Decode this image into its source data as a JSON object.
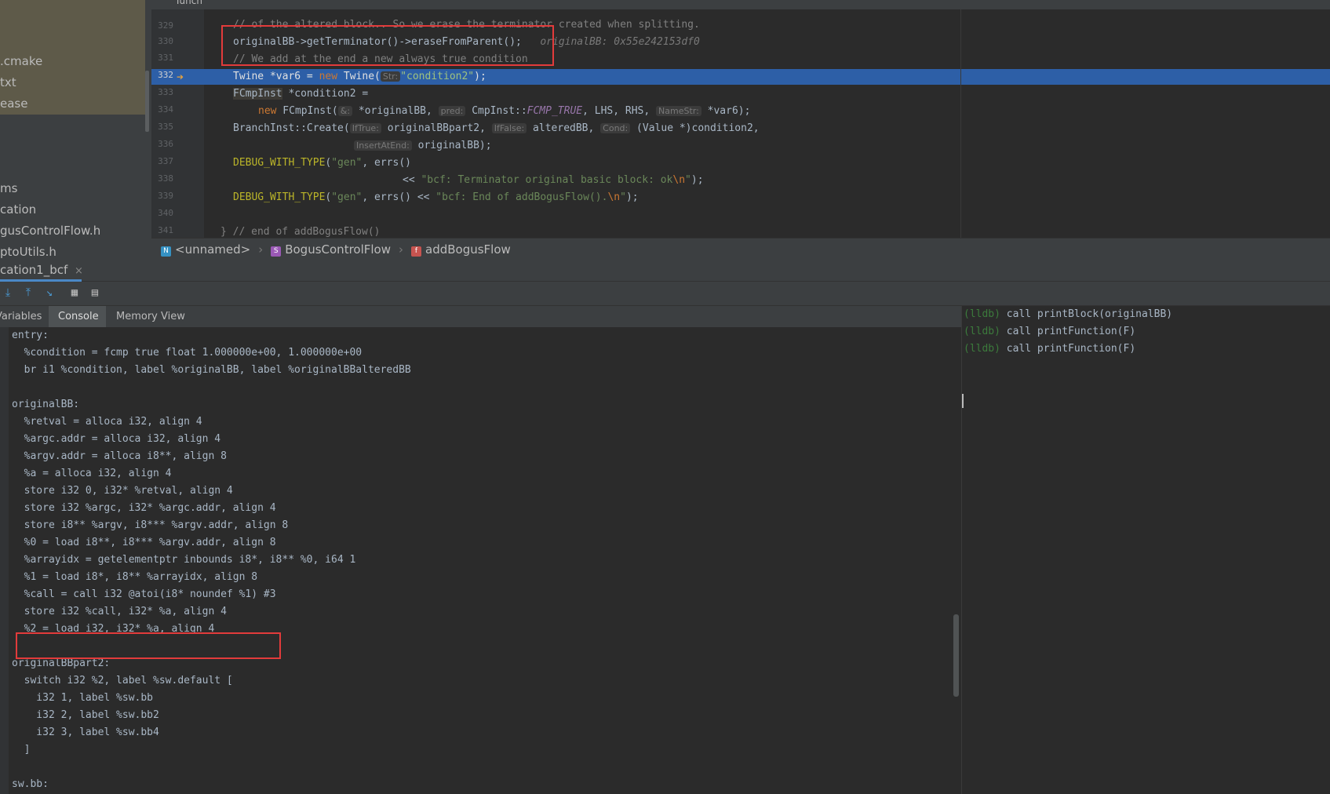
{
  "project_tree": {
    "items": [
      ".cmake",
      "txt",
      "ease",
      "ms",
      "cation",
      "gusControlFlow.h",
      "ptoUtils.h"
    ]
  },
  "editor": {
    "top_tab_label": "Tunch",
    "lines": [
      {
        "num": "329",
        "text": "// of the altered block.. So we erase the terminator created when splitting."
      },
      {
        "num": "330",
        "text": "originalBB->getTerminator()->eraseFromParent();",
        "inline": "originalBB: 0x55e242153df0"
      },
      {
        "num": "331",
        "text": "// We add at the end a new always true condition"
      },
      {
        "num": "332",
        "pre": "Twine *var6 = ",
        "kw": "new",
        "mid": " Twine(",
        "hint": "Str:",
        "str": "\"condition2\"",
        "post": ");"
      },
      {
        "num": "333",
        "type": "FCmpInst",
        "rest": " *condition2 ="
      },
      {
        "num": "334",
        "kw": "new",
        "a": " FCmpInst(",
        "h1": "&:",
        "b": " *originalBB, ",
        "h2": "pred:",
        "c": " CmpInst::",
        "enum": "FCMP_TRUE",
        "d": ", LHS, RHS, ",
        "h3": "NameStr:",
        "e": " *var6);"
      },
      {
        "num": "335",
        "a": "BranchInst::Create(",
        "h1": "IfTrue:",
        "b": " originalBBpart2, ",
        "h2": "IfFalse:",
        "c": " alteredBB, ",
        "h3": "Cond:",
        "d": " (Value *)condition2,"
      },
      {
        "num": "336",
        "h1": "InsertAtEnd:",
        "a": " originalBB);"
      },
      {
        "num": "337",
        "mac": "DEBUG_WITH_TYPE",
        "a": "(",
        "s1": "\"gen\"",
        "b": ", errs()"
      },
      {
        "num": "338",
        "a": "<< ",
        "s1": "\"bcf: Terminator original basic block: ok",
        "esc": "\\n",
        "s2": "\"",
        "b": ");"
      },
      {
        "num": "339",
        "mac": "DEBUG_WITH_TYPE",
        "a": "(",
        "s1": "\"gen\"",
        "b": ", errs() << ",
        "s2": "\"bcf: End of addBogusFlow().",
        "esc": "\\n",
        "s3": "\"",
        "c": ");"
      },
      {
        "num": "340",
        "text": ""
      },
      {
        "num": "341",
        "text": "} // end of addBogusFlow()"
      }
    ],
    "current_line": "332"
  },
  "breadcrumb": {
    "items": [
      {
        "badge": "N",
        "label": "<unnamed>",
        "color": "#3592c4"
      },
      {
        "badge": "S",
        "label": "BogusControlFlow",
        "color": "#9b59b6"
      },
      {
        "badge": "f",
        "label": "addBogusFlow",
        "color": "#c75450"
      }
    ]
  },
  "run_tab": {
    "label": "cation1_bcf",
    "close": "×"
  },
  "sub_tabs": [
    "Variables",
    "Console",
    "Memory View"
  ],
  "active_sub_tab": "Console",
  "console": {
    "lines": [
      "entry:",
      "  %condition = fcmp true float 1.000000e+00, 1.000000e+00",
      "  br i1 %condition, label %originalBB, label %originalBBalteredBB",
      "",
      "originalBB:",
      "  %retval = alloca i32, align 4",
      "  %argc.addr = alloca i32, align 4",
      "  %argv.addr = alloca i8**, align 8",
      "  %a = alloca i32, align 4",
      "  store i32 0, i32* %retval, align 4",
      "  store i32 %argc, i32* %argc.addr, align 4",
      "  store i8** %argv, i8*** %argv.addr, align 8",
      "  %0 = load i8**, i8*** %argv.addr, align 8",
      "  %arrayidx = getelementptr inbounds i8*, i8** %0, i64 1",
      "  %1 = load i8*, i8** %arrayidx, align 8",
      "  %call = call i32 @atoi(i8* noundef %1) #3",
      "  store i32 %call, i32* %a, align 4",
      "  %2 = load i32, i32* %a, align 4",
      "",
      "originalBBpart2:",
      "  switch i32 %2, label %sw.default [",
      "    i32 1, label %sw.bb",
      "    i32 2, label %sw.bb2",
      "    i32 3, label %sw.bb4",
      "  ]",
      "",
      "sw.bb:"
    ]
  },
  "lldb": {
    "prompt": "(lldb)",
    "commands": [
      "call printBlock(originalBB)",
      "call printFunction(F)",
      "call printFunction(F)"
    ]
  },
  "colors": {
    "accent": "#2d5fa7",
    "annotation": "#e23b3b"
  }
}
